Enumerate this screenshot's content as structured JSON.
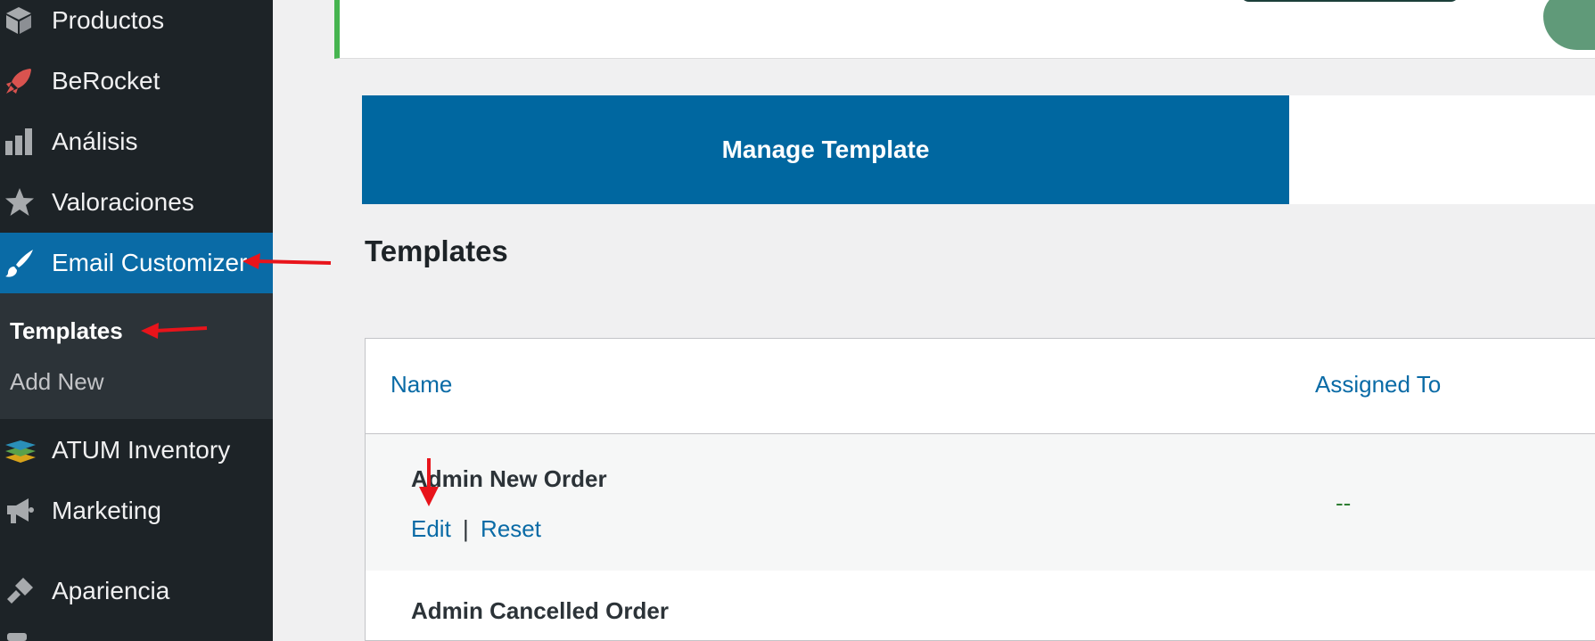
{
  "sidebar": {
    "items": [
      {
        "label": "Productos",
        "icon": "box-icon"
      },
      {
        "label": "BeRocket",
        "icon": "rocket-icon"
      },
      {
        "label": "Análisis",
        "icon": "bar-chart-icon"
      },
      {
        "label": "Valoraciones",
        "icon": "star-icon"
      },
      {
        "label": "Email Customizer",
        "icon": "paintbrush-icon"
      },
      {
        "label": "ATUM Inventory",
        "icon": "layers-icon"
      },
      {
        "label": "Marketing",
        "icon": "megaphone-icon"
      },
      {
        "label": "Apariencia",
        "icon": "paint-roller-icon"
      }
    ],
    "submenu": [
      {
        "label": "Templates"
      },
      {
        "label": "Add New"
      }
    ]
  },
  "tabs": {
    "manage": "Manage Template"
  },
  "page": {
    "title": "Templates"
  },
  "table": {
    "columns": [
      "Name",
      "Assigned To"
    ],
    "rows": [
      {
        "name": "Admin New Order",
        "edit": "Edit",
        "separator": "|",
        "reset": "Reset",
        "assigned": "--"
      },
      {
        "name": "Admin Cancelled Order"
      }
    ]
  },
  "colors": {
    "sidebar_bg": "#1d2327",
    "active_menu": "#0a6ba6",
    "tab_blue": "#0067a0",
    "link": "#0a6ba6",
    "annotation_arrow": "#e8141b"
  }
}
